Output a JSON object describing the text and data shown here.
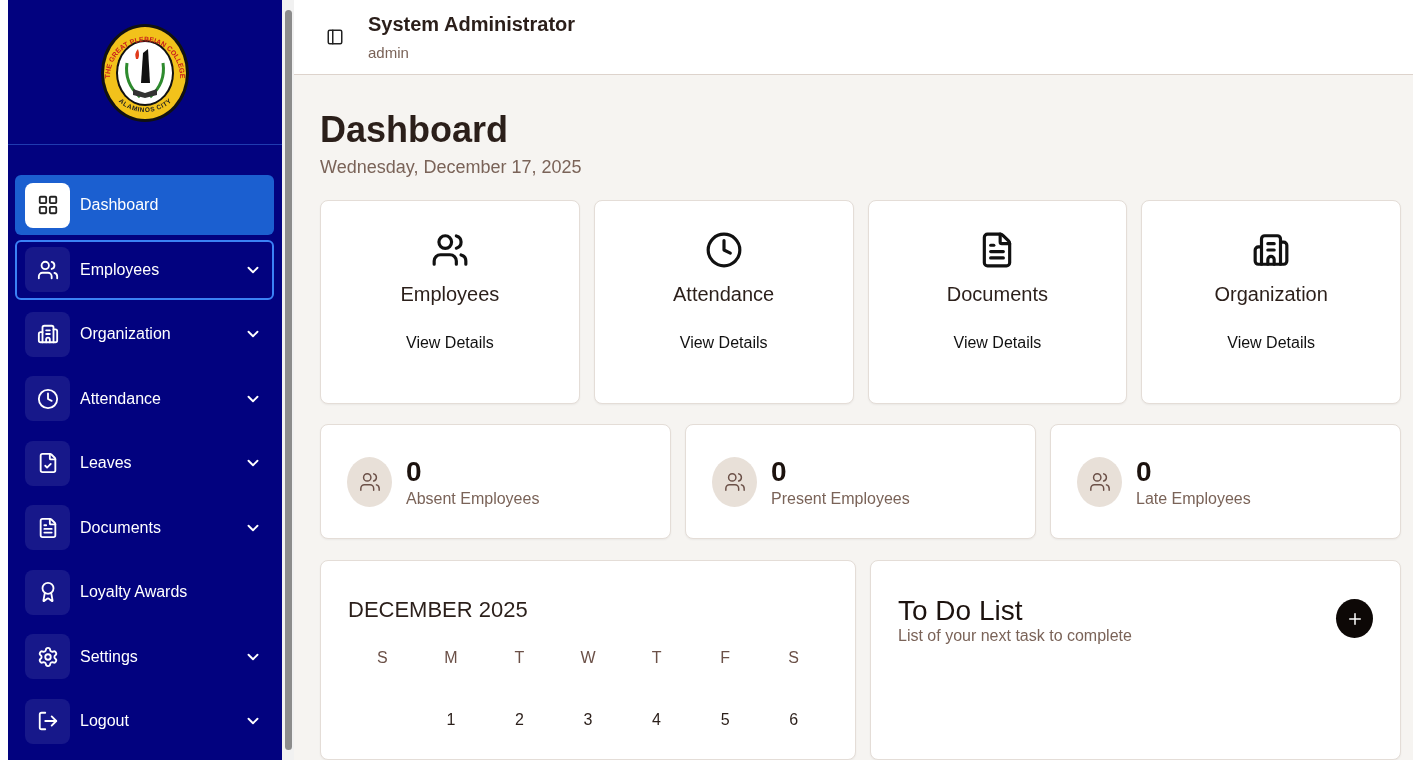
{
  "logo": {
    "top_text": "THE GREAT PLEBEIAN COLLEGE",
    "bottom_text": "ALAMINOS CITY"
  },
  "sidebar": {
    "items": [
      {
        "label": "Dashboard",
        "selected": true,
        "focused": false,
        "expandable": false
      },
      {
        "label": "Employees",
        "selected": false,
        "focused": true,
        "expandable": true
      },
      {
        "label": "Organization",
        "selected": false,
        "focused": false,
        "expandable": true
      },
      {
        "label": "Attendance",
        "selected": false,
        "focused": false,
        "expandable": true
      },
      {
        "label": "Leaves",
        "selected": false,
        "focused": false,
        "expandable": true
      },
      {
        "label": "Documents",
        "selected": false,
        "focused": false,
        "expandable": true
      },
      {
        "label": "Loyalty Awards",
        "selected": false,
        "focused": false,
        "expandable": false
      },
      {
        "label": "Settings",
        "selected": false,
        "focused": false,
        "expandable": true
      },
      {
        "label": "Logout",
        "selected": false,
        "focused": false,
        "expandable": true
      }
    ]
  },
  "header": {
    "user_name": "System Administrator",
    "role": "admin"
  },
  "page": {
    "title": "Dashboard",
    "date": "Wednesday, December 17, 2025"
  },
  "module_cards": [
    {
      "title": "Employees",
      "link": "View Details"
    },
    {
      "title": "Attendance",
      "link": "View Details"
    },
    {
      "title": "Documents",
      "link": "View Details"
    },
    {
      "title": "Organization",
      "link": "View Details"
    }
  ],
  "stats": [
    {
      "value": "0",
      "label": "Absent Employees"
    },
    {
      "value": "0",
      "label": "Present Employees"
    },
    {
      "value": "0",
      "label": "Late Employees"
    }
  ],
  "calendar": {
    "month": "DECEMBER 2025",
    "weekdays": [
      "S",
      "M",
      "T",
      "W",
      "T",
      "F",
      "S"
    ],
    "first_week": [
      "1",
      "2",
      "3",
      "4",
      "5",
      "6"
    ]
  },
  "todo": {
    "title": "To Do List",
    "subtitle": "List of your next task to complete"
  }
}
